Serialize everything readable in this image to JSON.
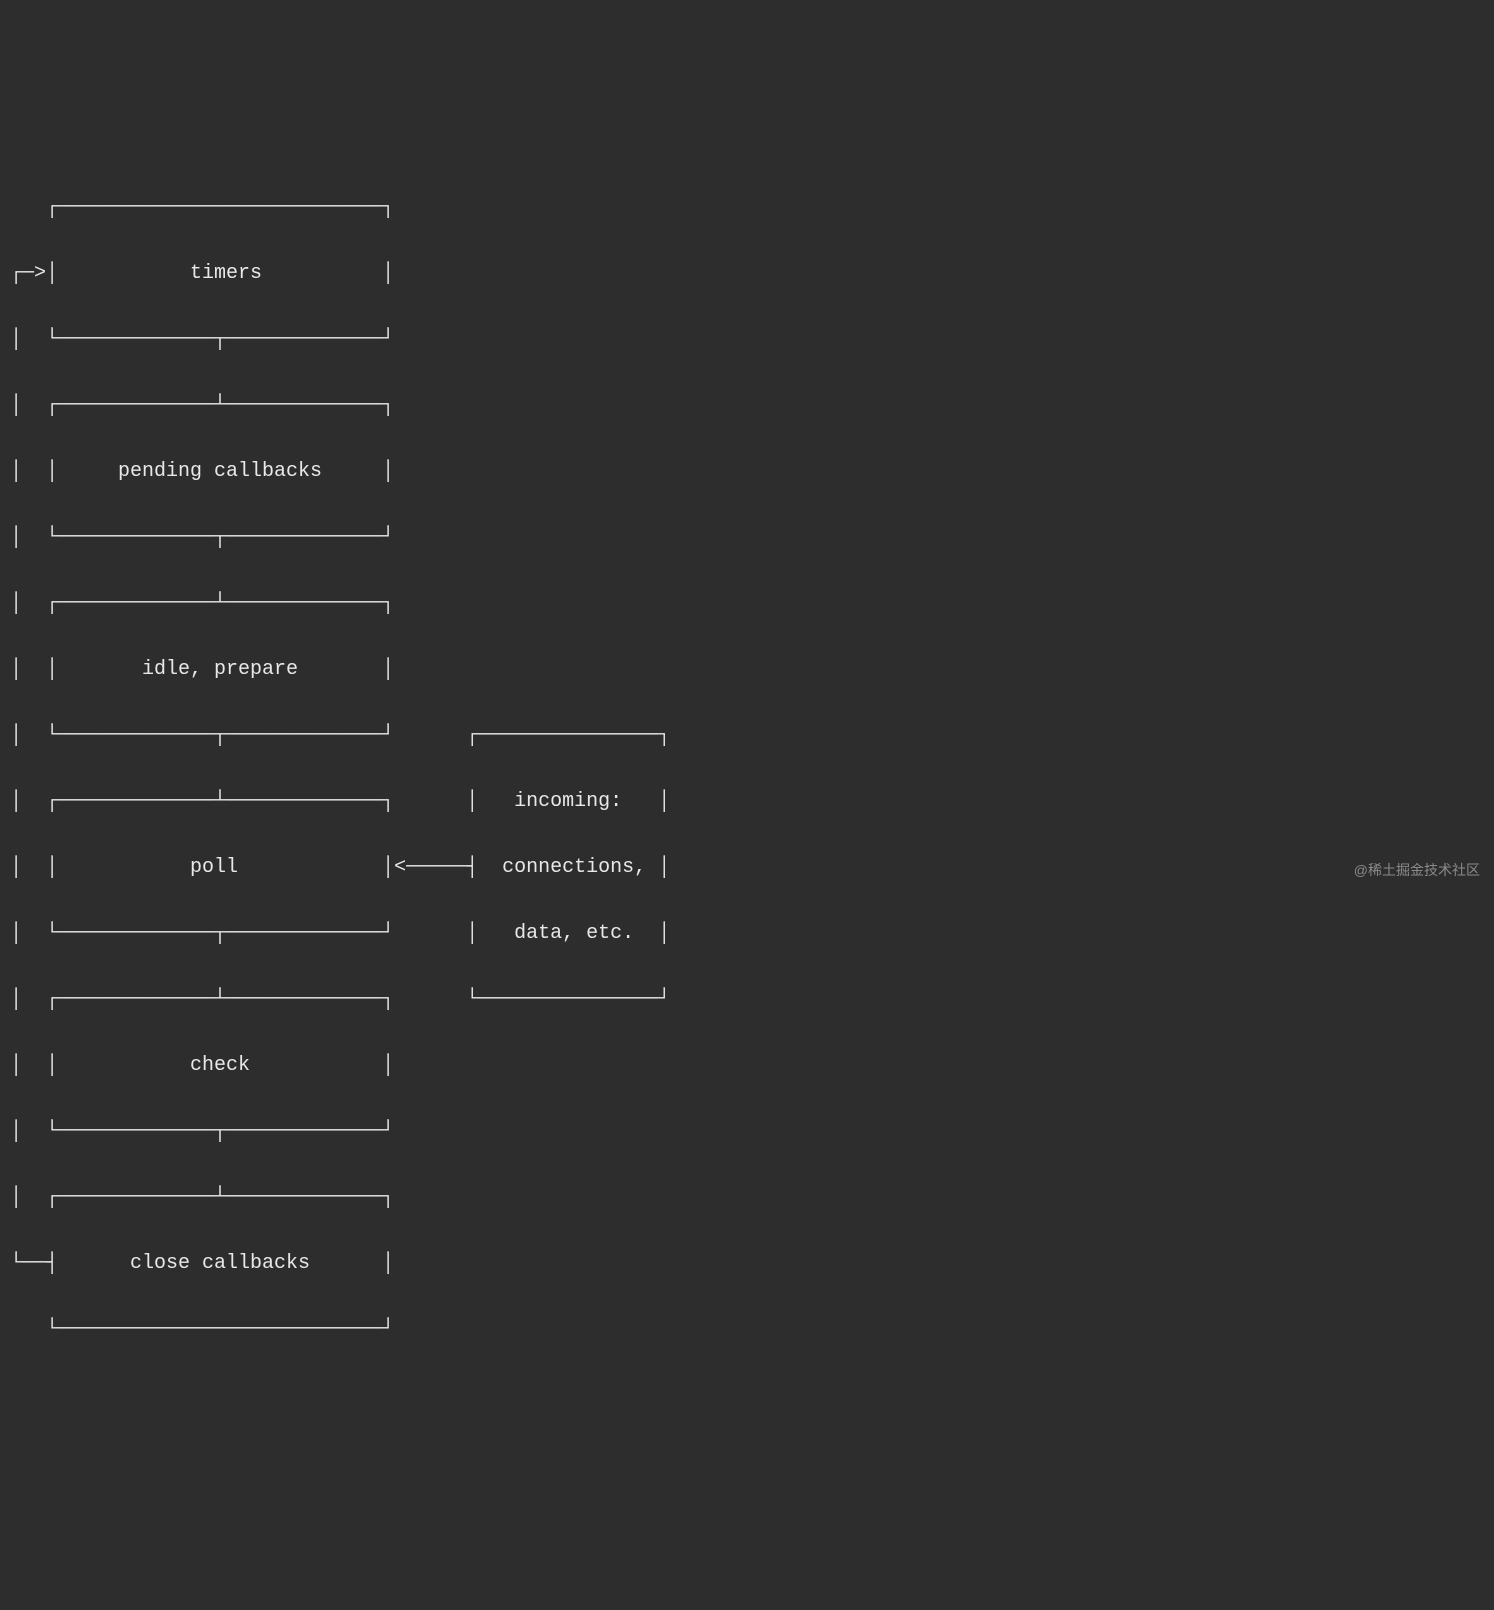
{
  "diagram": {
    "description": "Node.js Event Loop phases (ASCII box diagram)",
    "phases": [
      "timers",
      "pending callbacks",
      "idle, prepare",
      "poll",
      "check",
      "close callbacks"
    ],
    "side_box": {
      "lines": [
        "incoming:",
        "connections,",
        "data, etc."
      ]
    },
    "arrows": {
      "loop_back": "from bottom (close callbacks) back to timers (┌──>)",
      "incoming_to_poll": "<─────┤ from incoming box into poll phase"
    }
  },
  "ascii": {
    "l01": "   ┌───────────────────────────┐",
    "l02": "┌─>│           timers          │",
    "l03": "│  └─────────────┬─────────────┘",
    "l04": "│  ┌─────────────┴─────────────┐",
    "l05": "│  │     pending callbacks     │",
    "l06": "│  └─────────────┬─────────────┘",
    "l07": "│  ┌─────────────┴─────────────┐",
    "l08": "│  │       idle, prepare       │",
    "l09": "│  └─────────────┬─────────────┘      ┌───────────────┐",
    "l10": "│  ┌─────────────┴─────────────┐      │   incoming:   │",
    "l11": "│  │           poll            │<─────┤  connections, │",
    "l12": "│  └─────────────┬─────────────┘      │   data, etc.  │",
    "l13": "│  ┌─────────────┴─────────────┐      └───────────────┘",
    "l14": "│  │           check           │",
    "l15": "│  └─────────────┬─────────────┘",
    "l16": "│  ┌─────────────┴─────────────┐",
    "l17": "└──┤      close callbacks      │",
    "l18": "   └───────────────────────────┘"
  },
  "watermark": "@稀土掘金技术社区"
}
